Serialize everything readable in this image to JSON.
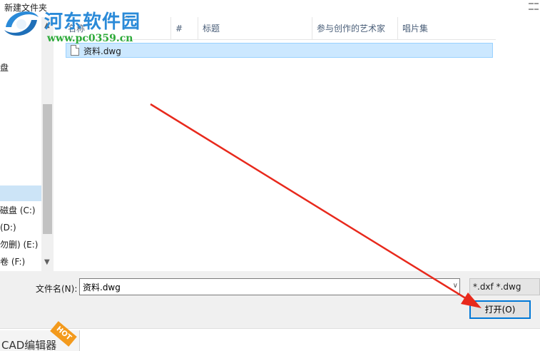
{
  "window": {
    "folder_title": "新建文件夹"
  },
  "watermark": {
    "title": "河东软件园",
    "url": "www.pc0359.cn"
  },
  "nav": {
    "items": [
      {
        "label": "盘"
      },
      {
        "label": ""
      },
      {
        "label": "磁盘 (C:)"
      },
      {
        "label": "(D:)"
      },
      {
        "label": "勿删) (E:)"
      },
      {
        "label": "卷 (F:)"
      }
    ]
  },
  "file_list": {
    "columns": [
      "名称",
      "#",
      "标题",
      "参与创作的艺术家",
      "唱片集"
    ],
    "files": [
      {
        "name": "资料.dwg",
        "selected": true
      }
    ]
  },
  "bottom": {
    "filename_label": "文件名(N):",
    "filename_value": "资料.dwg",
    "file_type": "*.dxf *.dwg",
    "open_label": "打开(O)"
  },
  "taskbar": {
    "app_label": "CAD编辑器",
    "badge": "HOT"
  },
  "colors": {
    "selection": "#cce8ff",
    "accent": "#0078d7",
    "annotation_arrow": "#e8291c",
    "watermark_title": "#2a8ad8",
    "watermark_url": "#2eaa3a"
  }
}
